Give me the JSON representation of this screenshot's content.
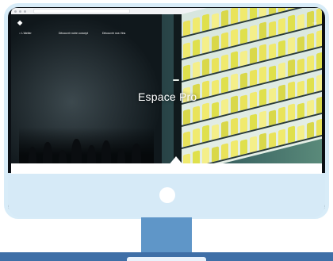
{
  "browser": {
    "url": ""
  },
  "site": {
    "logo": "◆",
    "nav": [
      {
        "label": "L'Atelier",
        "icon": "user-icon"
      },
      {
        "label": "Découvrir notre concept"
      },
      {
        "label": "Découvrir nos Vins"
      }
    ],
    "nav_right": {
      "link": "",
      "button": ""
    }
  },
  "hero": {
    "tag_prefix": "",
    "tag": "",
    "title": "Espace Pro"
  },
  "carousel": {
    "count": 3,
    "active": 2
  },
  "colors": {
    "bezel": "#0b0f14",
    "chin": "#d6eaf7",
    "stand": "#5f96c8",
    "base": "#3f6fa7"
  }
}
